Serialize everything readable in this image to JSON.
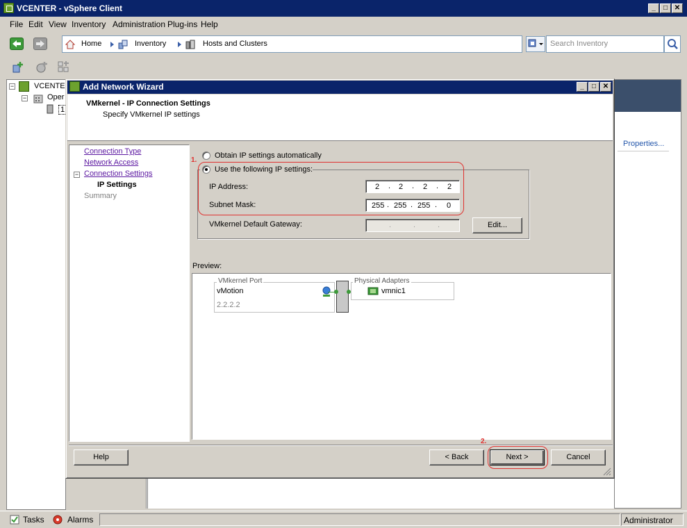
{
  "window": {
    "title": "VCENTER - vSphere Client",
    "min": "_",
    "max": "□",
    "close": "✕"
  },
  "menu": [
    "File",
    "Edit",
    "View",
    "Inventory",
    "Administration",
    "Plug-ins",
    "Help"
  ],
  "breadcrumb": [
    "Home",
    "Inventory",
    "Hosts and Clusters"
  ],
  "search": {
    "placeholder": "Search Inventory"
  },
  "tree": {
    "root": "VCENTER",
    "child": "Oper",
    "leaf": "1"
  },
  "right_pane": {
    "link": "Properties..."
  },
  "status": {
    "tasks": "Tasks",
    "alarms": "Alarms",
    "user": "Administrator"
  },
  "wizard": {
    "title": "Add Network Wizard",
    "heading": "VMkernel - IP Connection Settings",
    "subheading": "Specify VMkernel IP settings",
    "steps": [
      "Connection Type",
      "Network Access",
      "Connection Settings",
      "IP Settings",
      "Summary"
    ],
    "radio_auto": "Obtain IP settings automatically",
    "radio_manual": "Use the following IP settings:",
    "ip_label": "IP Address:",
    "ip": [
      "2",
      "2",
      "2",
      "2"
    ],
    "mask_label": "Subnet Mask:",
    "mask": [
      "255",
      "255",
      "255",
      "0"
    ],
    "gateway_label": "VMkernel Default Gateway:",
    "edit_button": "Edit...",
    "preview_label": "Preview:",
    "port_legend": "VMkernel Port",
    "port_name": "vMotion",
    "port_ip": "2.2.2.2",
    "adapters_legend": "Physical Adapters",
    "adapter": "vmnic1",
    "help_button": "Help",
    "back_button": "< Back",
    "next_button": "Next >",
    "cancel_button": "Cancel",
    "annotation_1": "1.",
    "annotation_2": "2."
  },
  "colors": {
    "titlebar": "#0a246a",
    "annotation": "#e0302e",
    "link": "#5a16a0"
  }
}
